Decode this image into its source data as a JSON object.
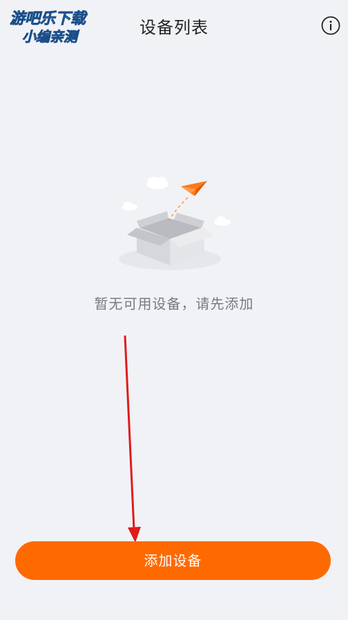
{
  "header": {
    "title": "设备列表",
    "info_icon": "info-circle-icon"
  },
  "watermark": {
    "line1": "游吧乐下载",
    "line2": "小编亲测"
  },
  "empty_state": {
    "illustration": "empty-box-with-paper-plane",
    "message": "暂无可用设备，请先添加"
  },
  "actions": {
    "add_device_label": "添加设备"
  },
  "colors": {
    "background": "#f1f2f6",
    "accent": "#ff6a00",
    "annotation_arrow": "#e01b1b"
  }
}
